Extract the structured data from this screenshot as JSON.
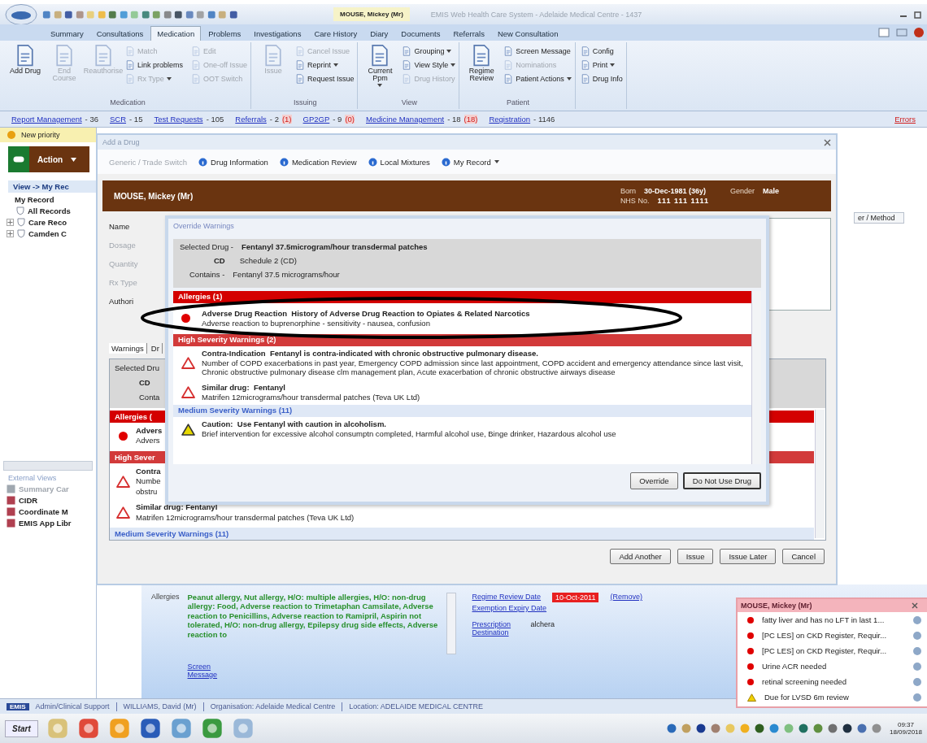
{
  "title_bar": {
    "patient_tab": "MOUSE, Mickey (Mr)",
    "title": "EMIS Web Health Care System - Adelaide Medical Centre - 1437"
  },
  "ribbon_tabs": [
    {
      "label": "Summary",
      "selected": false
    },
    {
      "label": "Consultations",
      "selected": false
    },
    {
      "label": "Medication",
      "selected": true
    },
    {
      "label": "Problems",
      "selected": false
    },
    {
      "label": "Investigations",
      "selected": false
    },
    {
      "label": "Care History",
      "selected": false
    },
    {
      "label": "Diary",
      "selected": false
    },
    {
      "label": "Documents",
      "selected": false
    },
    {
      "label": "Referrals",
      "selected": false
    },
    {
      "label": "New Consultation",
      "selected": false
    }
  ],
  "ribbon_groups": [
    {
      "label": "Medication",
      "buttons": [
        {
          "label": "Add Drug",
          "kind": "large",
          "disabled": false,
          "dropdown": false
        },
        {
          "label": "End Course",
          "kind": "large",
          "disabled": true,
          "dropdown": false
        },
        {
          "label": "Reauthorise",
          "kind": "large",
          "disabled": true,
          "dropdown": false
        },
        {
          "label": "Match",
          "kind": "small",
          "disabled": true,
          "dropdown": false
        },
        {
          "label": "Link problems",
          "kind": "small",
          "disabled": false,
          "dropdown": false
        },
        {
          "label": "Rx Type",
          "kind": "small",
          "disabled": true,
          "dropdown": true
        },
        {
          "label": "Edit",
          "kind": "small",
          "disabled": true,
          "dropdown": false
        },
        {
          "label": "One-off Issue",
          "kind": "small",
          "disabled": true,
          "dropdown": false
        },
        {
          "label": "OOT Switch",
          "kind": "small",
          "disabled": true,
          "dropdown": false
        }
      ]
    },
    {
      "label": "Issuing",
      "buttons": [
        {
          "label": "Issue",
          "kind": "large",
          "disabled": true,
          "dropdown": false
        },
        {
          "label": "Cancel Issue",
          "kind": "small",
          "disabled": true,
          "dropdown": false
        },
        {
          "label": "Reprint",
          "kind": "small",
          "disabled": false,
          "dropdown": true
        },
        {
          "label": "Request Issue",
          "kind": "small",
          "disabled": false,
          "dropdown": false
        }
      ]
    },
    {
      "label": "View",
      "buttons": [
        {
          "label": "Current Ppm",
          "kind": "large",
          "disabled": false,
          "dropdown": true
        },
        {
          "label": "Grouping",
          "kind": "small",
          "disabled": false,
          "dropdown": true
        },
        {
          "label": "View Style",
          "kind": "small",
          "disabled": false,
          "dropdown": true
        },
        {
          "label": "Drug History",
          "kind": "small",
          "disabled": true,
          "dropdown": false
        }
      ]
    },
    {
      "label": "Patient",
      "buttons": [
        {
          "label": "Regime Review",
          "kind": "large",
          "disabled": false,
          "dropdown": false
        },
        {
          "label": "Screen Message",
          "kind": "small",
          "disabled": false,
          "dropdown": false
        },
        {
          "label": "Nominations",
          "kind": "small",
          "disabled": true,
          "dropdown": false
        },
        {
          "label": "Patient Actions",
          "kind": "small",
          "disabled": false,
          "dropdown": true
        }
      ]
    },
    {
      "buttons": [
        {
          "label": "Config",
          "kind": "small",
          "disabled": false,
          "dropdown": false
        },
        {
          "label": "Print",
          "kind": "small",
          "disabled": false,
          "dropdown": true
        },
        {
          "label": "Drug Info",
          "kind": "small",
          "disabled": false,
          "dropdown": false
        }
      ]
    }
  ],
  "links_bar": {
    "links": [
      {
        "label": "Report Management",
        "count": "- 36"
      },
      {
        "label": "SCR",
        "count": "- 15"
      },
      {
        "label": "Test Requests",
        "count": "- 105"
      },
      {
        "label": "Referrals",
        "count": "- 2",
        "alert": "(1)"
      },
      {
        "label": "GP2GP",
        "count": "- 9",
        "alert": "(0)"
      },
      {
        "label": "Medicine Management",
        "count": "- 18",
        "alert": "(18)"
      },
      {
        "label": "Registration",
        "count": "- 1146"
      }
    ],
    "right_link": "Errors"
  },
  "left_panel": {
    "notification": "New priority",
    "action_button": "Action",
    "breadcrumb": "View -> My Rec",
    "tree": [
      {
        "label": "My Record",
        "kind": "root",
        "children": [
          {
            "label": "All Records",
            "kind": "leaf"
          },
          {
            "label": "Care Reco",
            "kind": "folder"
          },
          {
            "label": "Camden C",
            "kind": "folder"
          }
        ]
      }
    ],
    "external_views": {
      "label": "External Views",
      "items": [
        {
          "label": "Summary Car",
          "disabled": true
        },
        {
          "label": "CIDR",
          "disabled": false
        },
        {
          "label": "Coordinate M",
          "disabled": false
        },
        {
          "label": "EMIS App Libr",
          "disabled": false
        }
      ]
    }
  },
  "main": {
    "column_header": "er / Method"
  },
  "add_drug_dialog": {
    "title": "Add a Drug",
    "toolbar": [
      {
        "label": "Generic / Trade Switch",
        "disabled": true,
        "dropdown": false
      },
      {
        "label": "Drug Information",
        "disabled": false,
        "dropdown": false
      },
      {
        "label": "Medication Review",
        "disabled": false,
        "dropdown": false
      },
      {
        "label": "Local Mixtures",
        "disabled": false,
        "dropdown": false
      },
      {
        "label": "My Record",
        "disabled": false,
        "dropdown": true
      }
    ],
    "banner": {
      "name": "MOUSE, Mickey (Mr)",
      "born_label": "Born",
      "born": "30-Dec-1981 (36y)",
      "gender_label": "Gender",
      "gender": "Male",
      "nhs_label": "NHS No.",
      "nhs": "111 111 1111"
    },
    "form_labels": [
      {
        "label": "Name",
        "disabled": false
      },
      {
        "label": "Dosage",
        "disabled": true
      },
      {
        "label": "Quantity",
        "disabled": true
      },
      {
        "label": "Rx Type",
        "disabled": true
      },
      {
        "label": "Authori",
        "disabled": false
      }
    ],
    "tabs": [
      {
        "label": "Warnings",
        "selected": true
      },
      {
        "label": "Dr",
        "selected": false
      }
    ],
    "selected_drug": {
      "label": "Selected Dru",
      "cd": "CD",
      "contains": "Conta"
    },
    "warnings": [
      {
        "kind": "allergy_header",
        "label": "Allergies ("
      },
      {
        "kind": "allergy",
        "title": "Advers",
        "lines": [
          "Advers"
        ]
      },
      {
        "kind": "high_header",
        "label": "High Sever"
      },
      {
        "kind": "high",
        "title": "Contra",
        "lines": [
          "Numbe",
          "obstru"
        ]
      },
      {
        "kind": "high",
        "title": "Similar drug:  Fentanyl",
        "lines": [
          "Matrifen 12micrograms/hour transdermal patches (Teva UK Ltd)"
        ]
      },
      {
        "kind": "medium_header",
        "label": "Medium Severity Warnings (11)"
      }
    ],
    "buttons": [
      "Add Another",
      "Issue",
      "Issue Later",
      "Cancel"
    ]
  },
  "override_dialog": {
    "title": "Override Warnings",
    "selected_label": "Selected Drug -",
    "drug": "Fentanyl 37.5microgram/hour transdermal patches",
    "cd": "CD",
    "schedule": "Schedule 2 (CD)",
    "contains_label": "Contains -",
    "contains": "Fentanyl 37.5 micrograms/hour",
    "warnings": [
      {
        "kind": "allergy_header",
        "label": "Allergies (1)"
      },
      {
        "kind": "allergy",
        "type": "Adverse Drug Reaction",
        "title": "History of Adverse Drug Reaction to Opiates & Related Narcotics",
        "detail": "Adverse reaction to buprenorphine - sensitivity - nausea, confusion"
      },
      {
        "kind": "high_header",
        "label": "High Severity Warnings (2)"
      },
      {
        "kind": "high",
        "type": "Contra-Indication",
        "title": "Fentanyl is contra-indicated with chronic obstructive pulmonary disease.",
        "detail": "Number of COPD exacerbations in past year, Emergency COPD admission since last appointment, COPD accident and emergency attendance since last visit, Chronic obstructive pulmonary disease clm management plan, Acute exacerbation of chronic obstructive airways disease"
      },
      {
        "kind": "high",
        "type": "Similar drug:",
        "title": "Fentanyl",
        "detail": "Matrifen 12micrograms/hour transdermal patches (Teva UK Ltd)"
      },
      {
        "kind": "medium_header",
        "label": "Medium Severity Warnings (11)"
      },
      {
        "kind": "medium",
        "type": "Caution:",
        "title": "Use Fentanyl with caution in alcoholism.",
        "detail": "Brief intervention for excessive alcohol consumptn completed, Harmful alcohol use, Binge drinker, Hazardous alcohol use"
      }
    ],
    "buttons": [
      "Override",
      "Do Not Use Drug"
    ]
  },
  "summary": {
    "allergies_label": "Allergies",
    "allergies": "Peanut allergy, Nut allergy, H/O: multiple allergies, H/O: non-drug allergy: Food, Adverse reaction to Trimetaphan Camsilate, Adverse reaction to Penicillins, Adverse reaction to Ramipril, Aspirin not tolerated, H/O: non-drug allergy, Epilepsy drug side effects, Adverse reaction to",
    "screen_message": "Screen Message",
    "regime_review": "Regime Review Date",
    "regime_date": "10-Oct-2011",
    "remove": "(Remove)",
    "exemption": "Exemption Expiry Date",
    "destination": "Prescription Destination",
    "destination_value": "alchera"
  },
  "alerts_popup": {
    "title": "MOUSE, Mickey (Mr)",
    "items": [
      {
        "kind": "alert",
        "text": "fatty liver and has no LFT in last 1..."
      },
      {
        "kind": "alert",
        "text": "[PC LES] on CKD Register, Requir..."
      },
      {
        "kind": "alert",
        "text": "[PC LES] on CKD Register, Requir..."
      },
      {
        "kind": "alert",
        "text": "Urine ACR needed"
      },
      {
        "kind": "alert",
        "text": "retinal screening needed"
      },
      {
        "kind": "warning",
        "text": "Due for LVSD 6m review"
      }
    ]
  },
  "status_bar": {
    "badge": "EMIS",
    "items": [
      "Admin/Clinical Support",
      "WILLIAMS, David (Mr)",
      "Organisation: Adelaide Medical Centre",
      "Location: ADELAIDE MEDICAL CENTRE"
    ]
  },
  "taskbar": {
    "start": "Start",
    "time": "09:37",
    "date": "18/09/2018"
  }
}
